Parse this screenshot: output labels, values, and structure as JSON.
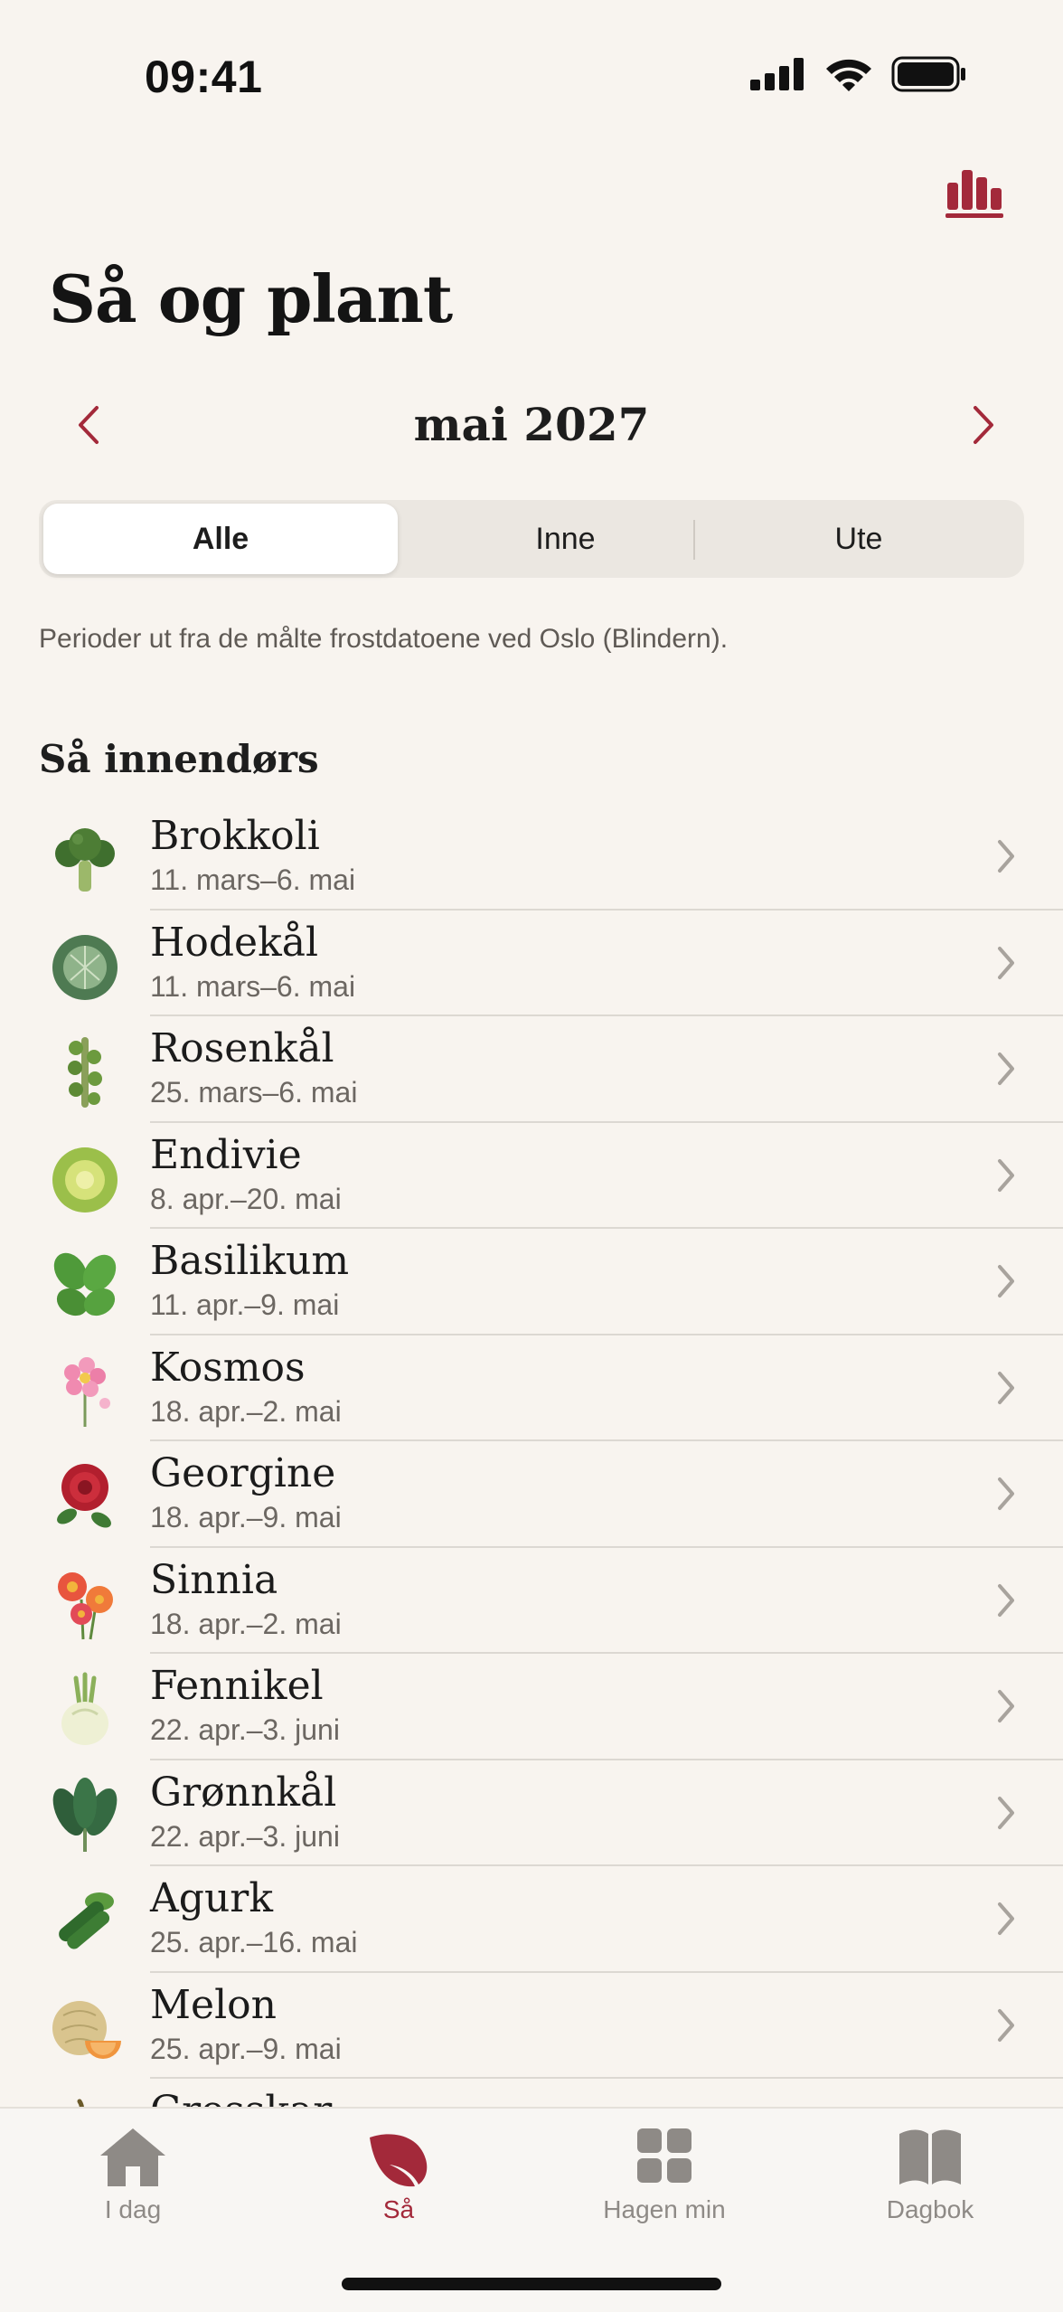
{
  "status_bar": {
    "time": "09:41"
  },
  "header": {
    "title": "Så og plant"
  },
  "month_nav": {
    "label": "mai 2027"
  },
  "segments": [
    "Alle",
    "Inne",
    "Ute"
  ],
  "selected_segment": "Alle",
  "info_text": "Perioder ut fra de målte frostdatoene ved Oslo (Blindern).",
  "section": {
    "heading": "Så innendørs",
    "items": [
      {
        "name": "Brokkoli",
        "range": "11. mars–6. mai",
        "icon": "broccoli-icon"
      },
      {
        "name": "Hodekål",
        "range": "11. mars–6. mai",
        "icon": "cabbage-icon"
      },
      {
        "name": "Rosenkål",
        "range": "25. mars–6. mai",
        "icon": "brussels-sprouts-icon"
      },
      {
        "name": "Endivie",
        "range": "8. apr.–20. mai",
        "icon": "endive-icon"
      },
      {
        "name": "Basilikum",
        "range": "11. apr.–9. mai",
        "icon": "basil-icon"
      },
      {
        "name": "Kosmos",
        "range": "18. apr.–2. mai",
        "icon": "cosmos-flower-icon"
      },
      {
        "name": "Georgine",
        "range": "18. apr.–9. mai",
        "icon": "dahlia-icon"
      },
      {
        "name": "Sinnia",
        "range": "18. apr.–2. mai",
        "icon": "zinnia-icon"
      },
      {
        "name": "Fennikel",
        "range": "22. apr.–3. juni",
        "icon": "fennel-icon"
      },
      {
        "name": "Grønnkål",
        "range": "22. apr.–3. juni",
        "icon": "kale-icon"
      },
      {
        "name": "Agurk",
        "range": "25. apr.–16. mai",
        "icon": "cucumber-icon"
      },
      {
        "name": "Melon",
        "range": "25. apr.–9. mai",
        "icon": "melon-icon"
      },
      {
        "name": "Gresskar",
        "range": "",
        "icon": "pumpkin-icon"
      }
    ]
  },
  "tabbar": {
    "tabs": [
      {
        "label": "I dag",
        "icon": "home-icon"
      },
      {
        "label": "Så",
        "icon": "leaf-icon"
      },
      {
        "label": "Hagen min",
        "icon": "grid-icon"
      },
      {
        "label": "Dagbok",
        "icon": "book-icon"
      }
    ],
    "active": "Så"
  },
  "colors": {
    "accent": "#a3293a",
    "background": "#f8f4ef"
  }
}
